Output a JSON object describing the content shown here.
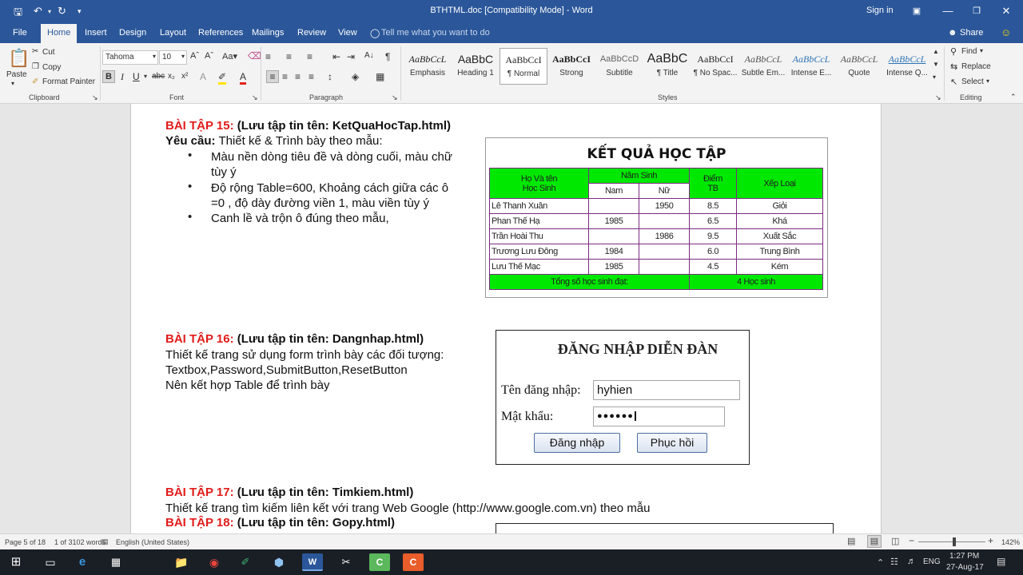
{
  "window": {
    "title": "BTHTML.doc [Compatibility Mode]  -  Word",
    "sign_in": "Sign in"
  },
  "menu": [
    "File",
    "Home",
    "Insert",
    "Design",
    "Layout",
    "References",
    "Mailings",
    "Review",
    "View"
  ],
  "tell_me": "Tell me what you want to do",
  "share": "Share",
  "ribbon": {
    "clipboard": {
      "paste": "Paste",
      "cut": "Cut",
      "copy": "Copy",
      "format_painter": "Format Painter",
      "label": "Clipboard"
    },
    "font": {
      "name": "Tahoma",
      "size": "10",
      "label": "Font"
    },
    "paragraph": {
      "label": "Paragraph"
    },
    "styles": {
      "label": "Styles",
      "items": [
        {
          "preview": "AaBbCcL",
          "name": "Emphasis"
        },
        {
          "preview": "AaBbC",
          "name": "Heading 1"
        },
        {
          "preview": "AaBbCcI",
          "name": "¶ Normal"
        },
        {
          "preview": "AaBbCcI",
          "name": "Strong"
        },
        {
          "preview": "AaBbCcD",
          "name": "Subtitle"
        },
        {
          "preview": "AaBbC",
          "name": "¶ Title"
        },
        {
          "preview": "AaBbCcI",
          "name": "¶ No Spac..."
        },
        {
          "preview": "AaBbCcL",
          "name": "Subtle Em..."
        },
        {
          "preview": "AaBbCcL",
          "name": "Intense E..."
        },
        {
          "preview": "AaBbCcL",
          "name": "Quote"
        },
        {
          "preview": "AaBbCcL",
          "name": "Intense Q..."
        }
      ]
    },
    "editing": {
      "find": "Find",
      "replace": "Replace",
      "select": "Select",
      "label": "Editing"
    }
  },
  "doc": {
    "bt15": {
      "title_red": "BÀI TẬP 15:",
      "title_rest": "(Lưu tập tin tên: KetQuaHocTap.html)",
      "req_label": "Yêu cầu:",
      "req_text": "Thiết kế & Trình bày theo mẫu:",
      "bullet1a": "Màu nền dòng tiêu đề và dòng cuối, màu chữ",
      "bullet1b": "tùy ý",
      "bullet2a": "Độ rộng Table=600, Khoảng cách giữa các ô",
      "bullet2b": "=0 , độ dày đường viền 1, màu viền tùy ý",
      "bullet3": "Canh lề và trộn ô đúng theo mẫu,"
    },
    "result_table": {
      "title": "KẾT QUẢ HỌC TẬP",
      "h_name1": "Họ Và tên",
      "h_name2": "Học Sinh",
      "h_year": "Năm Sinh",
      "h_male": "Nam",
      "h_female": "Nữ",
      "h_score1": "Điểm",
      "h_score2": "TB",
      "h_rank": "Xếp Loại",
      "rows": [
        {
          "name": "Lê Thanh Xuân",
          "nam": "",
          "nu": "1950",
          "score": "8.5",
          "rank": "Giỏi"
        },
        {
          "name": "Phan Thế Hạ",
          "nam": "1985",
          "nu": "",
          "score": "6.5",
          "rank": "Khá"
        },
        {
          "name": "Trần Hoài Thu",
          "nam": "",
          "nu": "1986",
          "score": "9.5",
          "rank": "Xuất Sắc"
        },
        {
          "name": "Trương Lưu Đông",
          "nam": "1984",
          "nu": "",
          "score": "6.0",
          "rank": "Trung Bình"
        },
        {
          "name": "Lưu Thế Mạc",
          "nam": "1985",
          "nu": "",
          "score": "4.5",
          "rank": "Kém"
        }
      ],
      "footer_label": "Tổng số học sinh đạt:",
      "footer_value": "4 Học sinh"
    },
    "bt16": {
      "title_red": "BÀI TẬP 16:",
      "title_rest": "(Lưu tập tin tên: Dangnhap.html)",
      "line1": "Thiết kế trang sử dụng form trình bày các đối tượng:",
      "line2": "Textbox,Password,SubmitButton,ResetButton",
      "line3": "Nên kết hợp Table để trình bày"
    },
    "login": {
      "title": "ĐĂNG NHẬP DIỄN ĐÀN",
      "user_label": "Tên đăng nhập:",
      "user_value": "hyhien",
      "pass_label": "Mật khẩu:",
      "pass_value": "●●●●●●",
      "submit": "Đăng nhập",
      "reset": "Phục hồi"
    },
    "bt17": {
      "title_red": "BÀI TẬP 17:",
      "title_rest": "(Lưu tập tin tên: Timkiem.html)",
      "line1": "Thiết kế trang tìm kiếm liên kết với trang Web Google (http://www.google.com.vn) theo mẫu"
    },
    "bt18": {
      "title_red": "BÀI TẬP 18:",
      "title_rest": "(Lưu tập tin tên: Gopy.html)"
    }
  },
  "status": {
    "page": "Page 5 of 18",
    "words": "1 of 3102 words",
    "lang": "English (United States)",
    "zoom": "142%"
  },
  "taskbar": {
    "lang": "ENG",
    "time": "1:27 PM",
    "date": "27-Aug-17"
  }
}
